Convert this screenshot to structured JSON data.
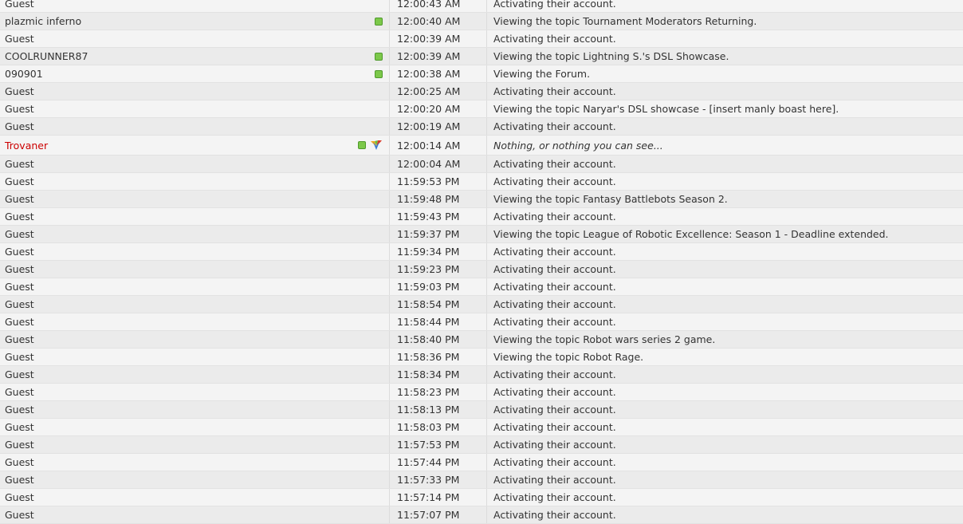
{
  "rows": [
    {
      "user": "Guest",
      "time": "12:00:43 AM",
      "activity": "Activating their account.",
      "online": false
    },
    {
      "user": "plazmic inferno",
      "time": "12:00:40 AM",
      "activity": "Viewing the topic Tournament Moderators Returning.",
      "online": true
    },
    {
      "user": "Guest",
      "time": "12:00:39 AM",
      "activity": "Activating their account.",
      "online": false
    },
    {
      "user": "COOLRUNNER87",
      "time": "12:00:39 AM",
      "activity": "Viewing the topic Lightning S.'s DSL Showcase.",
      "online": true
    },
    {
      "user": "090901",
      "time": "12:00:38 AM",
      "activity": "Viewing the Forum.",
      "online": true
    },
    {
      "user": "Guest",
      "time": "12:00:25 AM",
      "activity": "Activating their account.",
      "online": false
    },
    {
      "user": "Guest",
      "time": "12:00:20 AM",
      "activity": "Viewing the topic Naryar's DSL showcase - [insert manly boast here].",
      "online": false
    },
    {
      "user": "Guest",
      "time": "12:00:19 AM",
      "activity": "Activating their account.",
      "online": false
    },
    {
      "user": "Trovaner",
      "time": "12:00:14 AM",
      "activity": "Nothing, or nothing you can see...",
      "online": true,
      "badge": true,
      "red": true,
      "italic": true,
      "tall": true
    },
    {
      "user": "Guest",
      "time": "12:00:04 AM",
      "activity": "Activating their account.",
      "online": false
    },
    {
      "user": "Guest",
      "time": "11:59:53 PM",
      "activity": "Activating their account.",
      "online": false
    },
    {
      "user": "Guest",
      "time": "11:59:48 PM",
      "activity": "Viewing the topic Fantasy Battlebots Season 2.",
      "online": false
    },
    {
      "user": "Guest",
      "time": "11:59:43 PM",
      "activity": "Activating their account.",
      "online": false
    },
    {
      "user": "Guest",
      "time": "11:59:37 PM",
      "activity": "Viewing the topic League of Robotic Excellence: Season 1 - Deadline extended.",
      "online": false
    },
    {
      "user": "Guest",
      "time": "11:59:34 PM",
      "activity": "Activating their account.",
      "online": false
    },
    {
      "user": "Guest",
      "time": "11:59:23 PM",
      "activity": "Activating their account.",
      "online": false
    },
    {
      "user": "Guest",
      "time": "11:59:03 PM",
      "activity": "Activating their account.",
      "online": false
    },
    {
      "user": "Guest",
      "time": "11:58:54 PM",
      "activity": "Activating their account.",
      "online": false
    },
    {
      "user": "Guest",
      "time": "11:58:44 PM",
      "activity": "Activating their account.",
      "online": false
    },
    {
      "user": "Guest",
      "time": "11:58:40 PM",
      "activity": "Viewing the topic Robot wars series 2 game.",
      "online": false
    },
    {
      "user": "Guest",
      "time": "11:58:36 PM",
      "activity": "Viewing the topic Robot Rage.",
      "online": false
    },
    {
      "user": "Guest",
      "time": "11:58:34 PM",
      "activity": "Activating their account.",
      "online": false
    },
    {
      "user": "Guest",
      "time": "11:58:23 PM",
      "activity": "Activating their account.",
      "online": false
    },
    {
      "user": "Guest",
      "time": "11:58:13 PM",
      "activity": "Activating their account.",
      "online": false
    },
    {
      "user": "Guest",
      "time": "11:58:03 PM",
      "activity": "Activating their account.",
      "online": false
    },
    {
      "user": "Guest",
      "time": "11:57:53 PM",
      "activity": "Activating their account.",
      "online": false
    },
    {
      "user": "Guest",
      "time": "11:57:44 PM",
      "activity": "Activating their account.",
      "online": false
    },
    {
      "user": "Guest",
      "time": "11:57:33 PM",
      "activity": "Activating their account.",
      "online": false
    },
    {
      "user": "Guest",
      "time": "11:57:14 PM",
      "activity": "Activating their account.",
      "online": false
    },
    {
      "user": "Guest",
      "time": "11:57:07 PM",
      "activity": "Activating their account.",
      "online": false
    }
  ],
  "colors": {
    "staff_name": "#cc0000",
    "online": "#7cc84a"
  },
  "icons": {
    "online": "online-status-icon",
    "badge": "member-badge-icon"
  }
}
